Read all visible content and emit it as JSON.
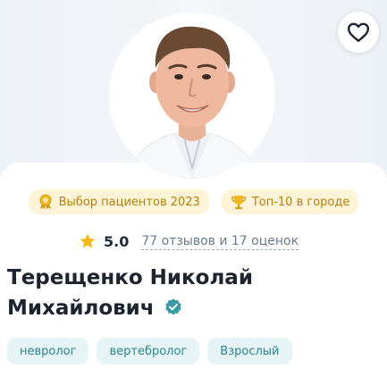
{
  "doctor": {
    "name_line1": "Терещенко Николай",
    "name_line2": "Михайлович"
  },
  "badges": [
    {
      "label": "Выбор пациентов 2023",
      "icon": "award-medal-icon"
    },
    {
      "label": "Топ-10 в городе",
      "icon": "trophy-icon"
    }
  ],
  "rating": {
    "score": "5.0",
    "reviews": "77 отзывов и 17 оценок"
  },
  "tags": [
    "невролог",
    "вертебролог",
    "Взрослый"
  ],
  "colors": {
    "badge_bg": "#fdf3d6",
    "badge_text": "#b2820f",
    "tag_bg": "#e6f4f5",
    "tag_text": "#2d8590",
    "verified": "#3a9aa6",
    "star": "#f5b60e"
  }
}
